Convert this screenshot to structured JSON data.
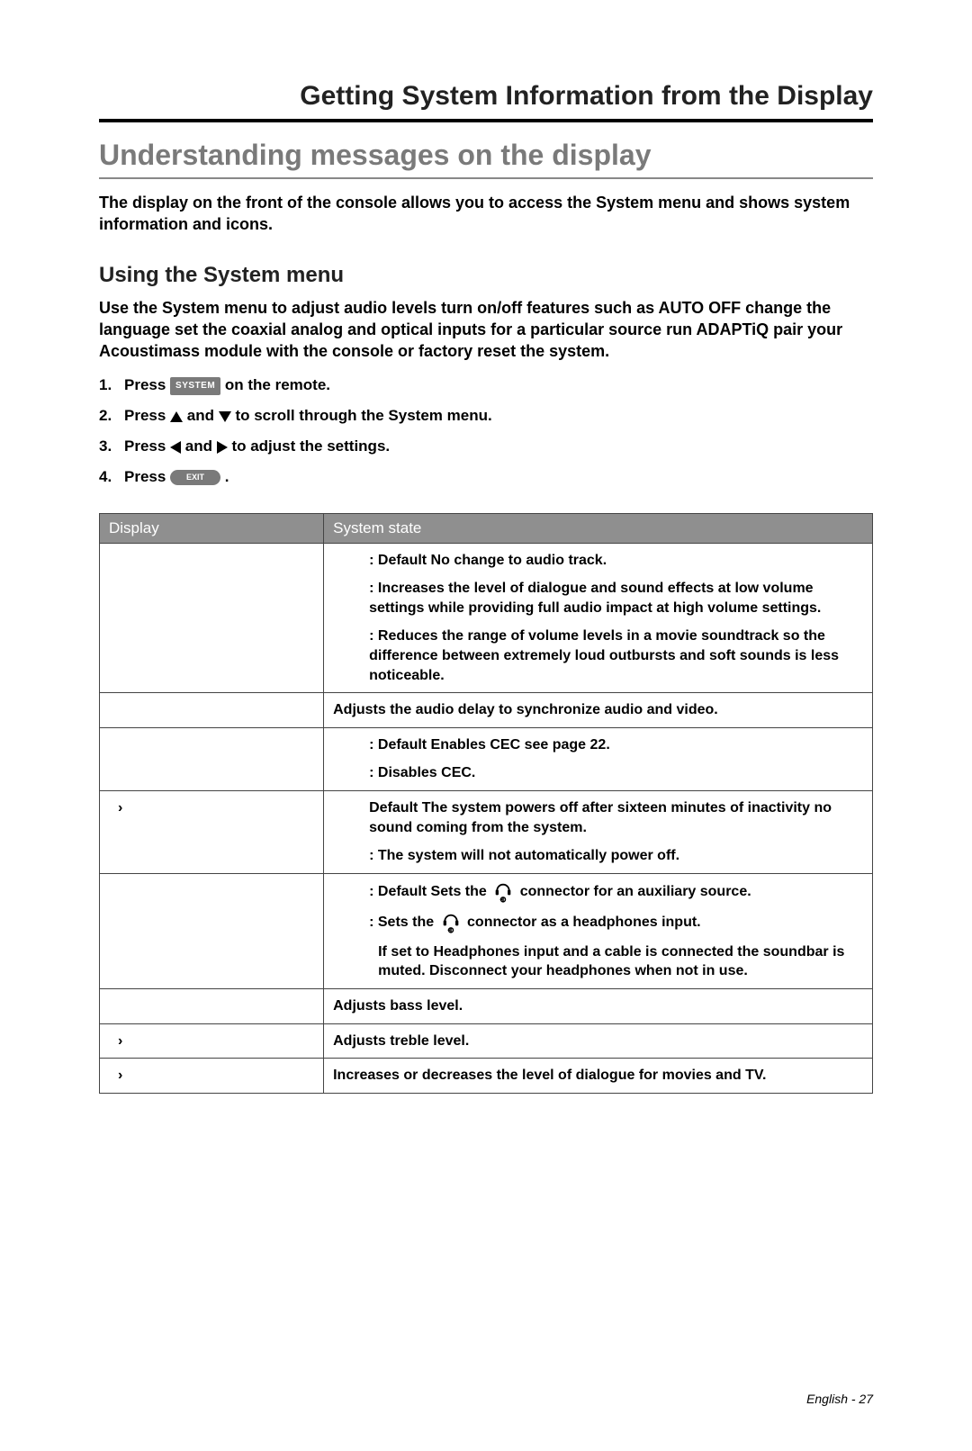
{
  "chapter_title": "Getting System Information from the Display",
  "section_title": "Understanding messages on the display",
  "intro": "The display on the front of the console allows you to access the System menu and shows system information and icons.",
  "subsection_title": "Using the System menu",
  "subintro": "Use the System menu to adjust audio levels turn on/off features such as AUTO OFF change the language set the coaxial analog and optical inputs for a particular source run ADAPTiQ pair your Acoustimass module with the console or factory reset the system.",
  "steps": {
    "s1a": "Press ",
    "s1b": " on the remote.",
    "s2a": "Press ",
    "s2b": " and ",
    "s2c": " to scroll through the System menu.",
    "s3a": "Press ",
    "s3b": " and ",
    "s3c": " to adjust the settings.",
    "s4a": "Press ",
    "s4b": " ."
  },
  "btn": {
    "system": "SYSTEM",
    "exit": "EXIT"
  },
  "table": {
    "head_display": "Display",
    "head_state": "System state",
    "rows": [
      {
        "display": "",
        "blocks": [
          {
            "text": ": Default No change to audio track.",
            "indent": true
          },
          {
            "text": ": Increases the level of dialogue and sound effects at low volume settings while providing full audio impact at high volume settings.",
            "indent": true,
            "hang": true
          },
          {
            "text": ": Reduces the range of volume levels in a movie soundtrack so the difference between extremely loud outbursts and soft sounds is less noticeable.",
            "indent": true,
            "hang": true
          }
        ]
      },
      {
        "display": "",
        "blocks": [
          {
            "text": "Adjusts the audio delay to synchronize audio and video."
          }
        ]
      },
      {
        "display": "",
        "blocks": [
          {
            "text": ": Default Enables CEC see page 22.",
            "indent": true
          },
          {
            "text": ": Disables CEC.",
            "indent": true
          }
        ]
      },
      {
        "display": "›",
        "blocks": [
          {
            "text": "Default The system powers off after sixteen minutes of inactivity no sound coming from the system.",
            "indent": true,
            "hang": true
          },
          {
            "text": ": The system will not automatically power off.",
            "indent": true
          }
        ]
      },
      {
        "display": "",
        "blocks": [
          {
            "aux_default": true
          },
          {
            "aux_headphones": true
          },
          {
            "note": "If set to Headphones input and a cable is connected the soundbar is muted. Disconnect your headphones when not in use."
          }
        ]
      },
      {
        "display": "",
        "blocks": [
          {
            "text": "Adjusts bass level."
          }
        ]
      },
      {
        "display": "›",
        "blocks": [
          {
            "text": "Adjusts treble level."
          }
        ]
      },
      {
        "display": "›",
        "blocks": [
          {
            "text": "Increases or decreases the level of dialogue for movies and TV."
          }
        ]
      }
    ],
    "aux_default_a": ": Default Sets the",
    "aux_default_b": "connector for an auxiliary source.",
    "aux_hp_a": ": Sets the",
    "aux_hp_b": "connector as a headphones input."
  },
  "footer": "English - 27"
}
